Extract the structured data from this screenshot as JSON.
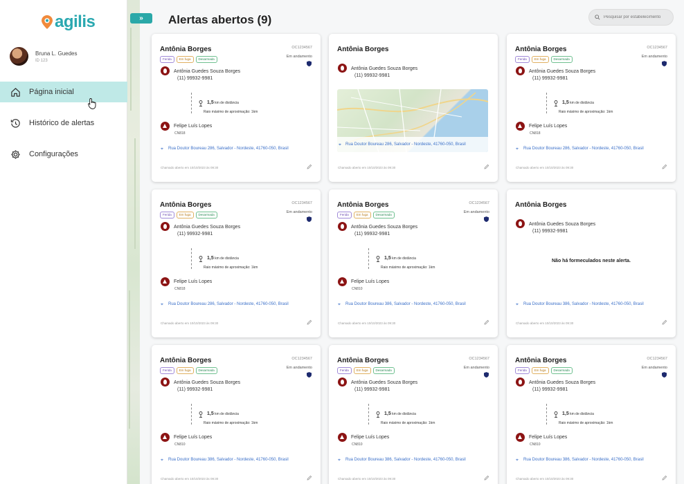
{
  "sidebar": {
    "logo_text": "agilis",
    "user": {
      "name": "Bruna L. Guedes",
      "id": "ID 123"
    },
    "nav": [
      {
        "label": "Página inicial",
        "icon": "home-icon",
        "active": true
      },
      {
        "label": "Histórico de alertas",
        "icon": "history-icon",
        "active": false
      },
      {
        "label": "Configurações",
        "icon": "gear-icon",
        "active": false
      }
    ]
  },
  "header": {
    "toggle_label": "»",
    "title": "Alertas abertos (9)",
    "search_placeholder": "Pesquisar por estabelecimento"
  },
  "colors": {
    "brand": "#2aa8b0",
    "accent_red": "#8c1414",
    "link": "#3a6fc8"
  },
  "cards": [
    {
      "type": "full",
      "name": "Antônia Borges",
      "code": "OC1234567",
      "status": "Em andamento",
      "tags": [
        "Ferida",
        "Em fuga",
        "Desarmada"
      ],
      "victim": "Antônia Guedes Souza Borges",
      "phone": "(11) 99932-9981",
      "distance": "1,5",
      "distance_unit": "km de distância",
      "radius": "Raio máximo de aproximação: 1km",
      "aggressor": "Felipe Luís Lopes",
      "aggressor_code": "CN818",
      "address": "Rua Doutor Boureau 286, Salvador - Nordeste, 41760-050, Brasil",
      "opened": "Chamado aberto em 10/10/2023 às 09:30"
    },
    {
      "type": "map",
      "name": "Antônia Borges",
      "victim": "Antônia Guedes Souza Borges",
      "phone": "(11) 99932-9981",
      "address": "Rua Doutor Boureau 286, Salvador - Nordeste, 41760-050, Brasil",
      "opened": "Chamado aberto em 10/10/2023 às 09:30"
    },
    {
      "type": "full",
      "name": "Antônia Borges",
      "code": "OC1234567",
      "status": "Em andamento",
      "tags": [
        "Ferida",
        "Em fuga",
        "Desarmada"
      ],
      "victim": "Antônia Guedes Souza Borges",
      "phone": "(11) 99932-9981",
      "distance": "1,5",
      "distance_unit": "km de distância",
      "radius": "Raio máximo de aproximação: 1km",
      "aggressor": "Felipe Luís Lopes",
      "aggressor_code": "CN818",
      "address": "Rua Doutor Boureau 286, Salvador - Nordeste, 41760-050, Brasil",
      "opened": "Chamado aberto em 10/10/2023 às 09:30"
    },
    {
      "type": "full",
      "name": "Antônia Borges",
      "code": "OC1234567",
      "status": "Em andamento",
      "tags": [
        "Ferida",
        "Em fuga",
        "Desarmada"
      ],
      "victim": "Antônia Guedes Souza Borges",
      "phone": "(11) 99932-9981",
      "distance": "1,5",
      "distance_unit": "km de distância",
      "radius": "Raio máximo de aproximação: 1km",
      "aggressor": "Felipe Luís Lopes",
      "aggressor_code": "CN818",
      "address": "Rua Doutor Boureau 286, Salvador - Nordeste, 41760-050, Brasil",
      "opened": "Chamado aberto em 10/10/2023 às 09:30"
    },
    {
      "type": "full",
      "name": "Antônia Borges",
      "code": "OC1234567",
      "status": "Em andamento",
      "tags": [
        "Ferida",
        "Em fuga",
        "Desarmada"
      ],
      "victim": "Antônia Guedes Souza Borges",
      "phone": "(11) 99932-9981",
      "distance": "1,5",
      "distance_unit": "km de distância",
      "radius": "Raio máximo de aproximação: 1km",
      "aggressor": "Felipe Luís Lopes",
      "aggressor_code": "CN810",
      "address": "Rua Doutor Boureau 386, Salvador - Nordeste, 41760-050, Brasil",
      "opened": "Chamado aberto em 10/10/2023 às 09:30"
    },
    {
      "type": "noagg",
      "name": "Antônia Borges",
      "victim": "Antônia Guedes Souza Borges",
      "phone": "(11) 99932-9981",
      "message": "Não há formeculados neste alerta.",
      "address": "Rua Doutor Boureau 386, Salvador - Nordeste, 41760-050, Brasil",
      "opened": "Chamado aberto em 10/10/2023 às 09:30"
    },
    {
      "type": "full",
      "name": "Antônia Borges",
      "code": "OC1234567",
      "status": "Em andamento",
      "tags": [
        "Ferida",
        "Em fuga",
        "Desarmada"
      ],
      "victim": "Antônia Guedes Souza Borges",
      "phone": "(11) 99932-9981",
      "distance": "1,5",
      "distance_unit": "km de distância",
      "radius": "Raio máximo de aproximação: 1km",
      "aggressor": "Felipe Luís Lopes",
      "aggressor_code": "CN810",
      "address": "Rua Doutor Boureau 386, Salvador - Nordeste, 41760-050, Brasil",
      "opened": "Chamado aberto em 10/10/2023 às 09:30"
    },
    {
      "type": "full",
      "name": "Antônia Borges",
      "code": "OC1234567",
      "status": "Em andamento",
      "tags": [
        "Ferida",
        "Em fuga",
        "Desarmada"
      ],
      "victim": "Antônia Guedes Souza Borges",
      "phone": "(11) 99932-9981",
      "distance": "1,5",
      "distance_unit": "km de distância",
      "radius": "Raio máximo de aproximação: 1km",
      "aggressor": "Felipe Luís Lopes",
      "aggressor_code": "CN810",
      "address": "Rua Doutor Boureau 386, Salvador - Nordeste, 41760-050, Brasil",
      "opened": "Chamado aberto em 10/10/2023 às 09:30"
    },
    {
      "type": "full",
      "name": "Antônia Borges",
      "code": "OC1234567",
      "status": "Em andamento",
      "tags": [
        "Ferida",
        "Em fuga",
        "Desarmada"
      ],
      "victim": "Antônia Guedes Souza Borges",
      "phone": "(11) 99932-9981",
      "distance": "1,5",
      "distance_unit": "km de distância",
      "radius": "Raio máximo de aproximação: 1km",
      "aggressor": "Felipe Luís Lopes",
      "aggressor_code": "CN810",
      "address": "Rua Doutor Boureau 386, Salvador - Nordeste, 41760-050, Brasil",
      "opened": "Chamado aberto em 10/10/2023 às 09:30"
    }
  ]
}
